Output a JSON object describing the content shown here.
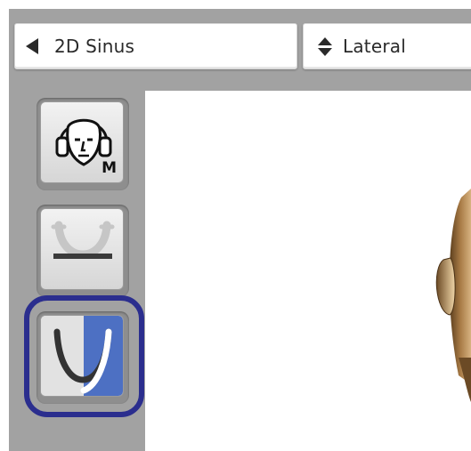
{
  "toolbar": {
    "exam_selector": {
      "label": "2D Sinus",
      "icon": "arrow-left-icon"
    },
    "view_selector": {
      "label": "Lateral",
      "icon": "up-down-arrows-icon"
    }
  },
  "sidebar": {
    "tools": [
      {
        "name": "patient-head-tool",
        "icon": "head-icon",
        "badge": "M"
      },
      {
        "name": "bite-block-tool",
        "icon": "bite-block-icon"
      },
      {
        "name": "jaw-side-tool",
        "icon": "jaw-arch-icon",
        "state": "selected"
      }
    ]
  },
  "colors": {
    "background": "#a2a2a2",
    "highlight_ring": "#2b2e8e",
    "jaw_panel_blue": "#4d70c3",
    "canvas": "#ffffff"
  }
}
